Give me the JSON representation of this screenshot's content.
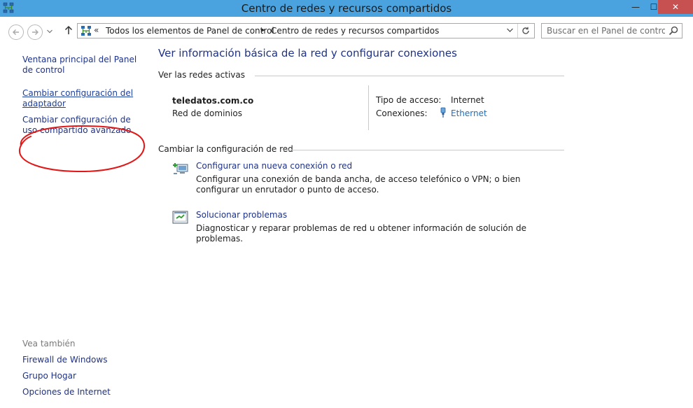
{
  "window": {
    "title": "Centro de redes y recursos compartidos",
    "minimize_glyph": "—",
    "maximize_glyph": "☐",
    "close_glyph": "✕"
  },
  "nav": {
    "breadcrumb_root_sep": "«",
    "breadcrumb": [
      "Todos los elementos de Panel de control",
      "Centro de redes y recursos compartidos"
    ],
    "breadcrumb_sep": "▸",
    "search_placeholder": "Buscar en el Panel de control"
  },
  "sidebar": {
    "links": [
      "Ventana principal del Panel de control",
      "Cambiar configuración del adaptador",
      "Cambiar configuración de uso compartido avanzado"
    ],
    "see_also_label": "Vea también",
    "see_also": [
      "Firewall de Windows",
      "Grupo Hogar",
      "Opciones de Internet"
    ]
  },
  "main": {
    "heading": "Ver información básica de la red y configurar conexiones",
    "active_networks_label": "Ver las redes activas",
    "network": {
      "name": "teledatos.com.co",
      "category": "Red de dominios",
      "access_type_label": "Tipo de acceso:",
      "access_type_value": "Internet",
      "connections_label": "Conexiones:",
      "connections_value": "Ethernet"
    },
    "change_settings_label": "Cambiar la configuración de red",
    "tasks": [
      {
        "title": "Configurar una nueva conexión o red",
        "description": "Configurar una conexión de banda ancha, de acceso telefónico o VPN; o bien configurar un enrutador o punto de acceso."
      },
      {
        "title": "Solucionar problemas",
        "description": "Diagnosticar y reparar problemas de red u obtener información de solución de problemas."
      }
    ]
  },
  "colors": {
    "titlebar": "#4aa3df",
    "link": "#1e3287",
    "close_button": "#c75050",
    "annotation": "#e01818"
  }
}
